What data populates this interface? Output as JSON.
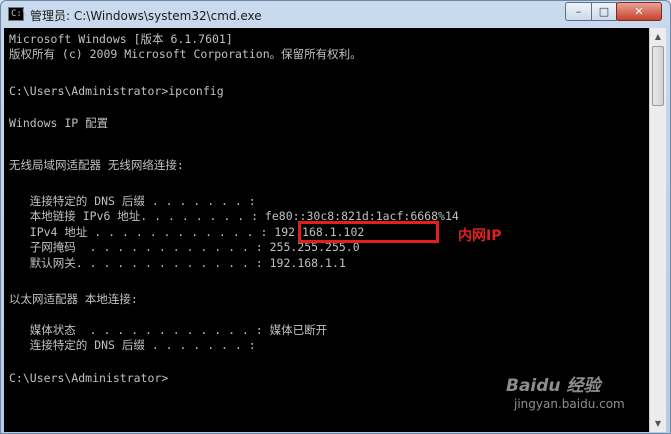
{
  "window": {
    "title": "管理员: C:\\Windows\\system32\\cmd.exe",
    "buttons": {
      "minimize": "–",
      "maximize": "□",
      "close": "✕"
    }
  },
  "console": {
    "lines": [
      "Microsoft Windows [版本 6.1.7601]",
      "版权所有 (c) 2009 Microsoft Corporation。保留所有权利。",
      "",
      "C:\\Users\\Administrator>ipconfig",
      "",
      "Windows IP 配置",
      "",
      "",
      "无线局域网适配器 无线网络连接:",
      "",
      "   连接特定的 DNS 后缀 . . . . . . . :",
      "   本地链接 IPv6 地址. . . . . . . . : fe80::30c8:821d:1acf:6668%14",
      "   IPv4 地址 . . . . . . . . . . . . : 192.168.1.102",
      "   子网掩码  . . . . . . . . . . . . : 255.255.255.0",
      "   默认网关. . . . . . . . . . . . . : 192.168.1.1",
      "",
      "以太网适配器 本地连接:",
      "",
      "   媒体状态  . . . . . . . . . . . . : 媒体已断开",
      "   连接特定的 DNS 后缀 . . . . . . . :",
      "",
      "C:\\Users\\Administrator>"
    ]
  },
  "annotation": {
    "label": "内网IP"
  },
  "watermark": {
    "brand": "Baidu 经验",
    "url": "jingyan.baidu.com"
  },
  "colors": {
    "console_bg": "#000000",
    "console_text": "#c0c0c0",
    "annotation": "#e1201e"
  }
}
